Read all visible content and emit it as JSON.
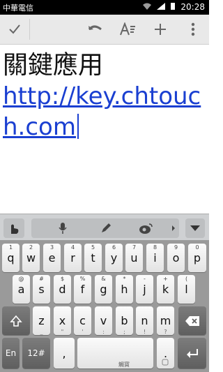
{
  "status": {
    "carrier": "中華電信",
    "time": "20:28"
  },
  "toolbar": {
    "done_icon": "check-icon",
    "undo_icon": "undo-icon",
    "format_icon": "text-format-icon",
    "add_icon": "plus-icon",
    "more_icon": "overflow-menu-icon"
  },
  "content": {
    "title": "關鍵應用",
    "link_line1": "http://key.chtouc",
    "link_line2": "h.com"
  },
  "keyboard": {
    "row1": [
      {
        "key": "q",
        "hint": "1"
      },
      {
        "key": "w",
        "hint": "2"
      },
      {
        "key": "e",
        "hint": "3"
      },
      {
        "key": "r",
        "hint": "4"
      },
      {
        "key": "t",
        "hint": "5"
      },
      {
        "key": "y",
        "hint": "6"
      },
      {
        "key": "u",
        "hint": "7"
      },
      {
        "key": "i",
        "hint": "8"
      },
      {
        "key": "o",
        "hint": "9"
      },
      {
        "key": "p",
        "hint": "0"
      }
    ],
    "row2": [
      {
        "key": "a",
        "hint": "@"
      },
      {
        "key": "s",
        "hint": "#"
      },
      {
        "key": "d",
        "hint": "$"
      },
      {
        "key": "f",
        "hint": "%"
      },
      {
        "key": "g",
        "hint": "&"
      },
      {
        "key": "h",
        "hint": "*"
      },
      {
        "key": "j",
        "hint": "-"
      },
      {
        "key": "k",
        "hint": "+"
      },
      {
        "key": "l",
        "hint": "("
      }
    ],
    "row3": [
      {
        "key": "z",
        "sub": "_"
      },
      {
        "key": "x",
        "sub": "\""
      },
      {
        "key": "c",
        "sub": "'"
      },
      {
        "key": "v",
        "sub": ":"
      },
      {
        "key": "b",
        "sub": ";"
      },
      {
        "key": "n",
        "sub": "!"
      },
      {
        "key": "m",
        "sub": "?"
      }
    ],
    "row4": {
      "lang": "En",
      "symbols": "12#",
      "comma": ",",
      "space_sub": "觸寶",
      "period": "."
    },
    "shift_icon": "shift-icon",
    "backspace_icon": "backspace-icon",
    "enter_icon": "enter-icon",
    "emoji_icon": "emoji-icon",
    "mic_icon": "mic-icon",
    "pen_icon": "pen-icon",
    "weibo_icon": "weibo-icon",
    "collapse_icon": "collapse-keyboard-icon",
    "hand_icon": "touchpal-hand-icon"
  }
}
